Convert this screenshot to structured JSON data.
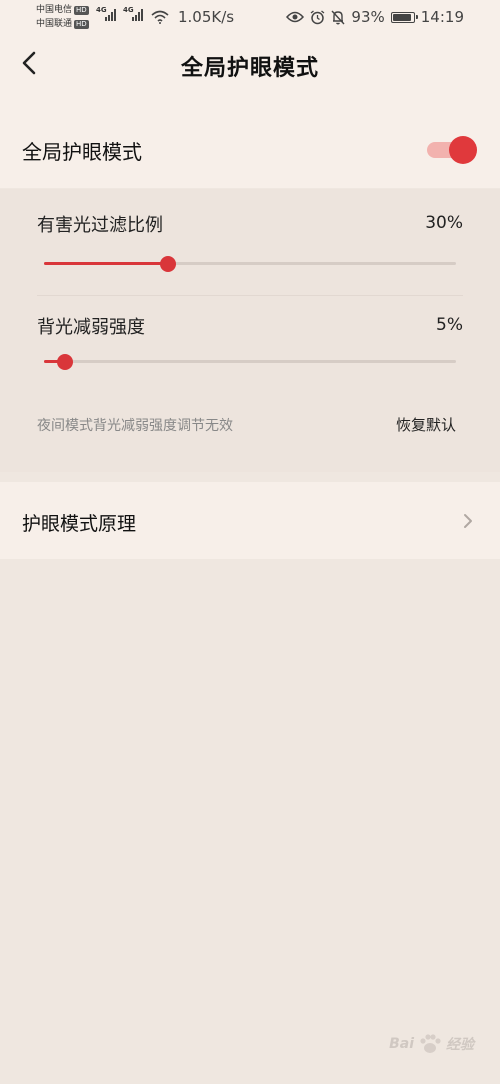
{
  "status_bar": {
    "carrier_1": "中国电信",
    "carrier_2": "中国联通",
    "hd_label": "HD",
    "network_type": "4G",
    "net_speed": "1.05K/s",
    "battery_percent": "93%",
    "battery_level": 0.93,
    "time": "14:19",
    "icons": [
      "eye-icon",
      "alarm-icon",
      "mute-bell-icon",
      "battery-icon",
      "wifi-icon",
      "signal-icon"
    ]
  },
  "header": {
    "title": "全局护眼模式",
    "back_icon": "back-arrow-icon"
  },
  "global_mode": {
    "label": "全局护眼模式",
    "enabled": true
  },
  "filter": {
    "label": "有害光过滤比例",
    "value_text": "30%",
    "value": 0.3
  },
  "backlight": {
    "label": "背光减弱强度",
    "value_text": "5%",
    "value": 0.05
  },
  "hint": "夜间模式背光减弱强度调节无效",
  "reset_label": "恢复默认",
  "principle": {
    "label": "护眼模式原理",
    "icon": "chevron-right-icon"
  },
  "watermark": {
    "left_text": "Bai",
    "right_text": "经验"
  },
  "colors": {
    "accent": "#e0393c",
    "track_on": "#f2b2ae",
    "background": "#efe7e0",
    "card": "#f7efe9"
  }
}
